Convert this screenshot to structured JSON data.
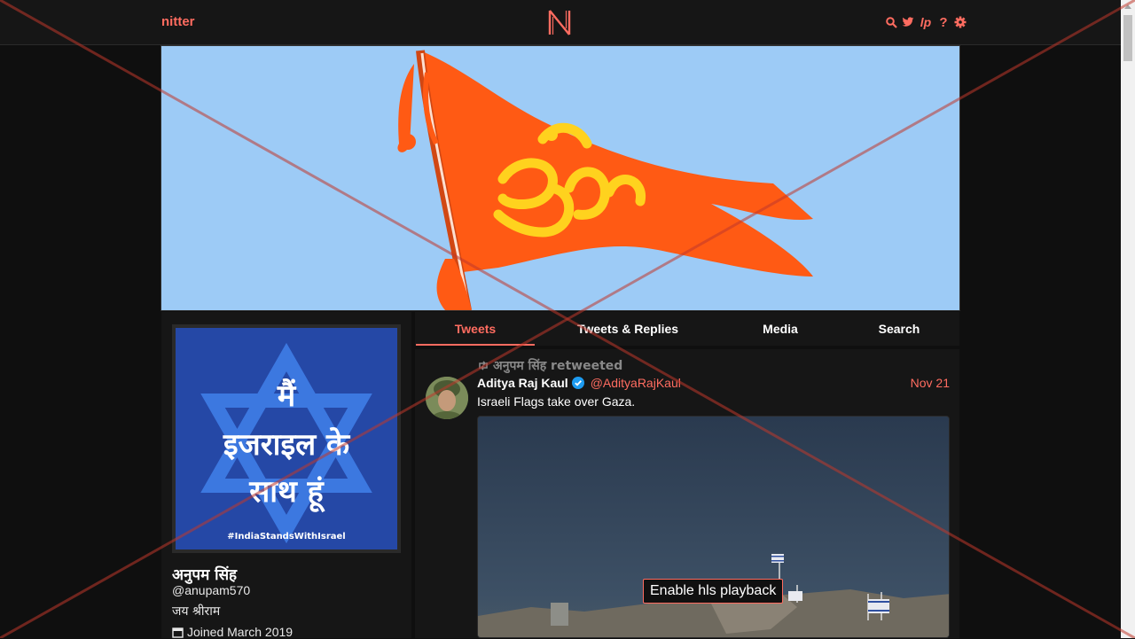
{
  "nav": {
    "brand": "nitter",
    "logo_letter": "N",
    "icons": [
      "search-icon",
      "twitter-icon",
      "lp-icon",
      "help-icon",
      "gear-icon"
    ]
  },
  "profile": {
    "name": "अनुपम सिंह",
    "handle": "@anupam570",
    "bio": "जय श्रीराम",
    "joined": "Joined March 2019",
    "avatar_lines": [
      "मैं",
      "इजराइल के",
      "साथ हूं"
    ],
    "avatar_hashtag": "#IndiaStandsWithIsrael"
  },
  "tabs": [
    "Tweets",
    "Tweets & Replies",
    "Media",
    "Search"
  ],
  "tweet": {
    "retweet_label": "अनुपम सिंह retweeted",
    "author_name": "Aditya Raj Kaul",
    "author_handle": "@AdityaRajKaul",
    "date": "Nov 21",
    "text": "Israeli Flags take over Gaza.",
    "media_button": "Enable hls playback"
  },
  "colors": {
    "accent": "#ff6c60",
    "background": "#0f0f0f",
    "panel": "#161616",
    "banner_sky": "#9dcbf6",
    "flag_saffron": "#ff5a14"
  }
}
